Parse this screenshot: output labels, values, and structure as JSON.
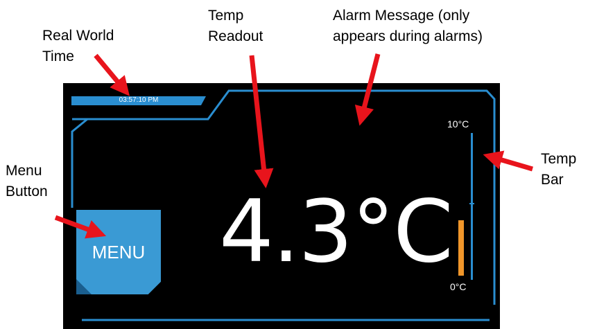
{
  "callouts": {
    "real_world_time": "Real World\nTime",
    "temp_readout": "Temp\nReadout",
    "alarm_message": "Alarm Message (only\nappears during alarms)",
    "menu_button": "Menu\nButton",
    "temp_bar": "Temp\nBar"
  },
  "device": {
    "clock": "03:57:10 PM",
    "temperature": "4.3°C",
    "temperature_fraction_of_bar": 0.43,
    "menu_label": "MENU",
    "bar_max_label": "10°C",
    "bar_min_label": "0°C",
    "alarm_message": ""
  },
  "colors": {
    "accent": "#2a8ed0",
    "menu": "#3a9ad4",
    "bar_fill": "#f0962a",
    "arrow": "#e8141c",
    "screen": "#000000"
  }
}
